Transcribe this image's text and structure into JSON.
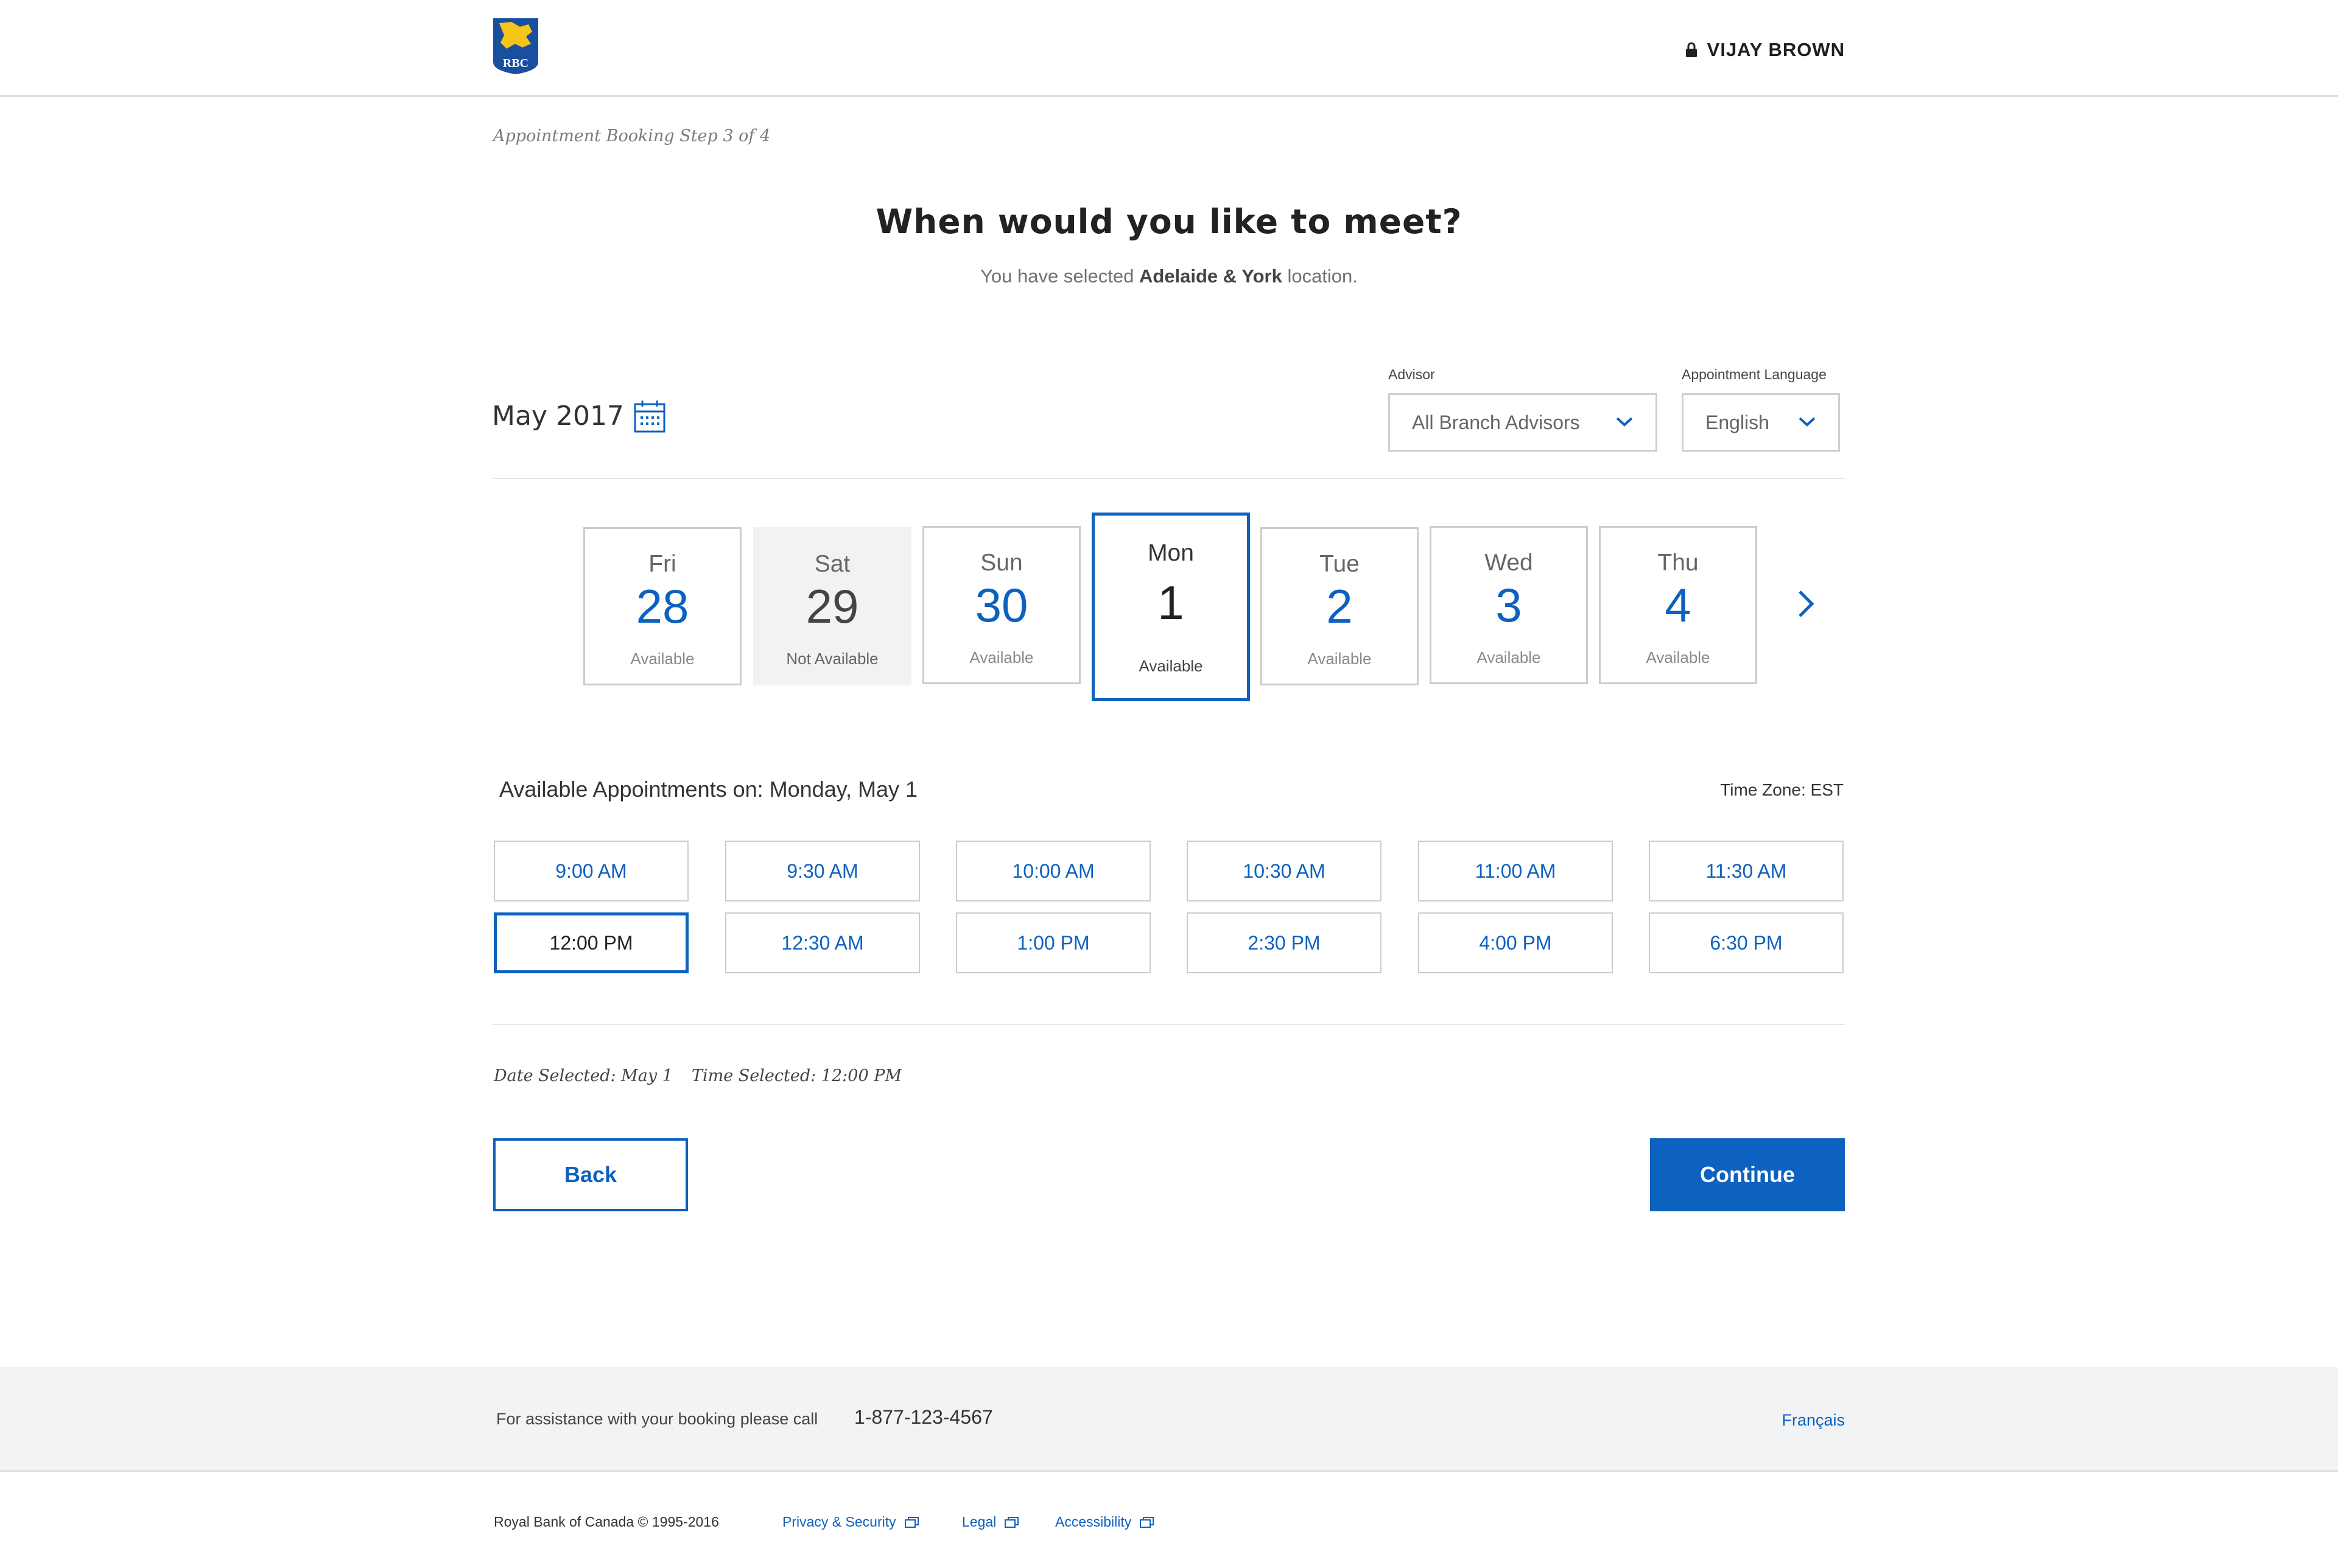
{
  "header": {
    "logo_text": "RBC",
    "user_name": "VIJAY BROWN"
  },
  "breadcrumb": "Appointment Booking Step 3 of 4",
  "page": {
    "title": "When would you like to meet?",
    "subtitle_prefix": "You have selected ",
    "subtitle_location": "Adelaide & York",
    "subtitle_suffix": " location."
  },
  "calendar": {
    "month": "May 2017",
    "advisor_label": "Advisor",
    "advisor_value": "All Branch Advisors",
    "language_label": "Appointment Language",
    "language_value": "English"
  },
  "days": [
    {
      "name": "Fri",
      "num": "28",
      "status": "Available",
      "state": "available"
    },
    {
      "name": "Sat",
      "num": "29",
      "status": "Not Available",
      "state": "unavailable"
    },
    {
      "name": "Sun",
      "num": "30",
      "status": "Available",
      "state": "available"
    },
    {
      "name": "Mon",
      "num": "1",
      "status": "Available",
      "state": "selected"
    },
    {
      "name": "Tue",
      "num": "2",
      "status": "Available",
      "state": "available"
    },
    {
      "name": "Wed",
      "num": "3",
      "status": "Available",
      "state": "available"
    },
    {
      "name": "Thu",
      "num": "4",
      "status": "Available",
      "state": "available"
    }
  ],
  "appointments": {
    "heading": "Available Appointments on: Monday, May 1",
    "timezone": "Time Zone: EST",
    "slots": [
      "9:00 AM",
      "9:30 AM",
      "10:00 AM",
      "10:30 AM",
      "11:00 AM",
      "11:30 AM",
      "12:00 PM",
      "12:30 AM",
      "1:00 PM",
      "2:30 PM",
      "4:00 PM",
      "6:30 PM"
    ],
    "selected_slot": "12:00 PM"
  },
  "selection": {
    "date": "Date Selected: May 1",
    "time": "Time Selected: 12:00 PM"
  },
  "actions": {
    "back": "Back",
    "continue": "Continue"
  },
  "footer": {
    "assist": "For assistance with your booking please call",
    "phone": "1-877-123-4567",
    "language_link": "Français",
    "copyright": "Royal Bank of Canada © 1995-2016",
    "links": [
      "Privacy & Security",
      "Legal",
      "Accessibility"
    ]
  },
  "colors": {
    "brand_blue": "#0d61bf",
    "logo_blue": "#1a4f9f",
    "logo_gold": "#f5c518"
  }
}
